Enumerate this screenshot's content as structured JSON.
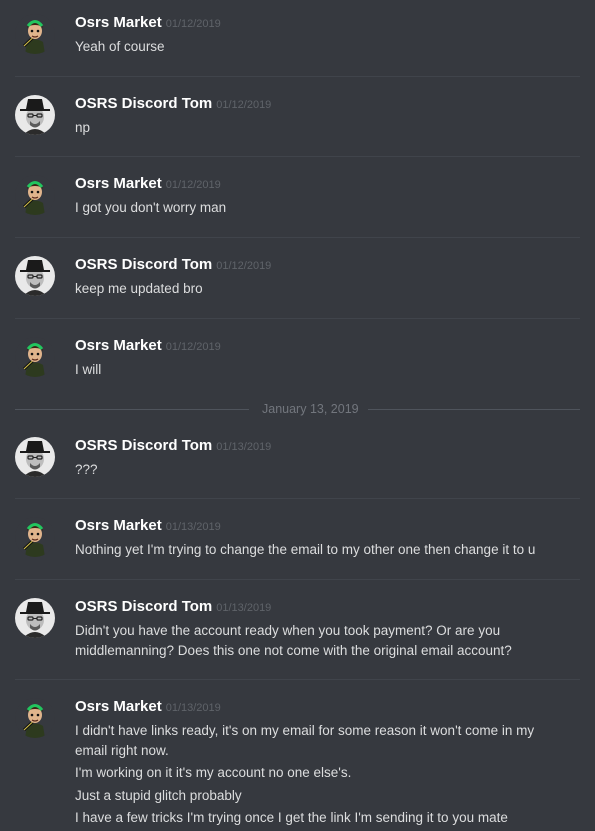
{
  "messages": [
    {
      "author": "Osrs Market",
      "avatar": "osrs-market-avatar",
      "timestamp": "01/12/2019",
      "lines": [
        "Yeah of course"
      ]
    },
    {
      "author": "OSRS Discord Tom",
      "avatar": "discord-tom-avatar",
      "timestamp": "01/12/2019",
      "lines": [
        "np"
      ]
    },
    {
      "author": "Osrs Market",
      "avatar": "osrs-market-avatar",
      "timestamp": "01/12/2019",
      "lines": [
        "I got you don't worry man"
      ]
    },
    {
      "author": "OSRS Discord Tom",
      "avatar": "discord-tom-avatar",
      "timestamp": "01/12/2019",
      "lines": [
        "keep me updated bro"
      ]
    },
    {
      "author": "Osrs Market",
      "avatar": "osrs-market-avatar",
      "timestamp": "01/12/2019",
      "lines": [
        "I will"
      ]
    },
    {
      "author": "OSRS Discord Tom",
      "avatar": "discord-tom-avatar",
      "timestamp": "01/13/2019",
      "lines": [
        "???"
      ]
    },
    {
      "author": "Osrs Market",
      "avatar": "osrs-market-avatar",
      "timestamp": "01/13/2019",
      "lines": [
        "Nothing yet I'm trying to change the email to my other one then change it to u"
      ]
    },
    {
      "author": "OSRS Discord Tom",
      "avatar": "discord-tom-avatar",
      "timestamp": "01/13/2019",
      "lines": [
        "Didn't you have the account ready when you took payment? Or are you middlemanning? Does this one not come with the original email account?"
      ]
    },
    {
      "author": "Osrs Market",
      "avatar": "osrs-market-avatar",
      "timestamp": "01/13/2019",
      "lines": [
        "I didn't have links ready, it's on my email for some reason it won't come in my email right now.",
        "I'm working on it it's my account no one else's.",
        "Just a stupid glitch probably",
        "I have a few tricks I'm trying once I get the link I'm sending it to you mate"
      ]
    }
  ],
  "day_divider": "January 13, 2019",
  "colors": {
    "background": "#36393f",
    "username": "#ffffff",
    "message_text": "#dcddde",
    "timestamp": "#5f6369",
    "separator": "#40444b"
  }
}
